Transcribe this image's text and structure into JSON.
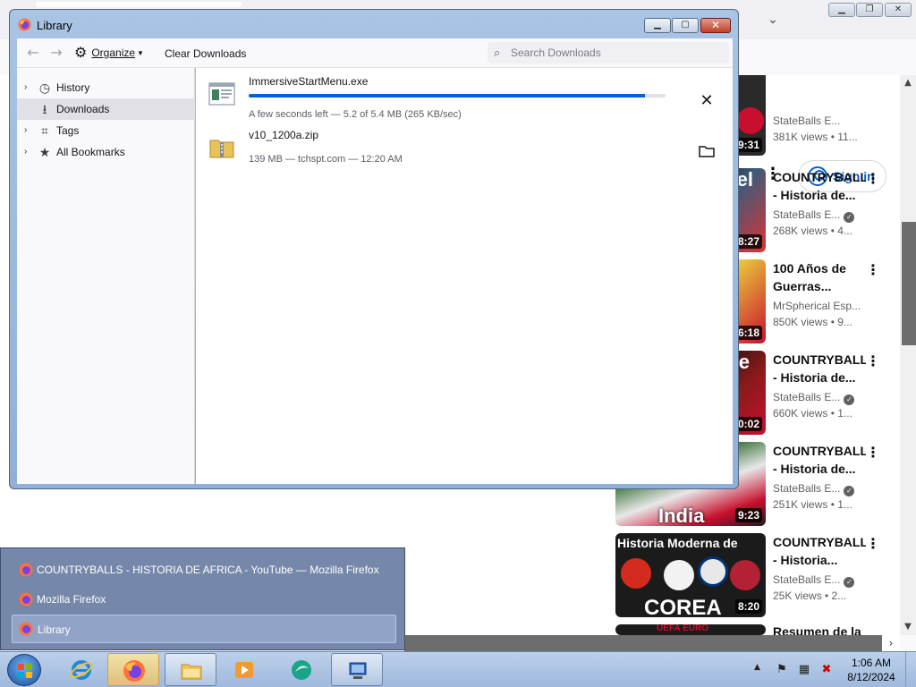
{
  "library": {
    "title": "Library",
    "toolbar": {
      "organize_label": "Organize",
      "clear_label": "Clear Downloads",
      "search_placeholder": "Search Downloads"
    },
    "sidebar": {
      "items": [
        {
          "label": "History",
          "icon": "clock-icon"
        },
        {
          "label": "Downloads",
          "icon": "download-icon"
        },
        {
          "label": "Tags",
          "icon": "tag-icon"
        },
        {
          "label": "All Bookmarks",
          "icon": "star-icon"
        }
      ]
    },
    "downloads": [
      {
        "name": "ImmersiveStartMenu.exe",
        "status": "A few seconds left — 5.2 of 5.4 MB (265 KB/sec)",
        "progress": 0.95,
        "action": "cancel"
      },
      {
        "name": "v10_1200a.zip",
        "status": "139 MB — tchspt.com — 12:20 AM",
        "action": "open-folder"
      }
    ]
  },
  "jumplist": {
    "items": [
      {
        "label": "COUNTRYBALLS - HISTORIA DE AFRICA - YouTube — Mozilla Firefox"
      },
      {
        "label": "Mozilla Firefox"
      },
      {
        "label": "Library",
        "selected": true
      }
    ]
  },
  "youtube": {
    "signin_label": "Sign in",
    "videos": [
      {
        "title1": "",
        "title2": "",
        "channel": "StateBalls E...",
        "meta": "381K views • 11...",
        "duration": "9:31"
      },
      {
        "title1": "COUNTRYBALLS",
        "title2": "- Historia de...",
        "channel": "StateBalls E...",
        "meta": "268K views • 4...",
        "duration": "8:27",
        "thumb_text": "el"
      },
      {
        "title1": "100 Años de",
        "title2": "Guerras...",
        "channel": "MrSpherical Esp...",
        "meta": "850K views • 9...",
        "duration": "6:18"
      },
      {
        "title1": "COUNTRYBALLS",
        "title2": "- Historia de...",
        "channel": "StateBalls E...",
        "meta": "660K views • 1...",
        "duration": "0:02",
        "thumb_text": "e"
      },
      {
        "title1": "COUNTRYBALLS",
        "title2": "- Historia de...",
        "channel": "StateBalls E...",
        "meta": "251K views • 1...",
        "duration": "9:23",
        "thumb_text": "India"
      },
      {
        "title1": "COUNTRYBALLS",
        "title2": "- Historia...",
        "channel": "StateBalls E...",
        "meta": "25K views • 2...",
        "duration": "8:20",
        "thumb_text": "COREA",
        "thumb_top": "Historia Moderna de"
      },
      {
        "title1": "Resumen de la",
        "title2": "",
        "thumb_top": "UEFA EURO"
      }
    ]
  },
  "taskbar": {
    "clock_time": "1:06 AM",
    "clock_date": "8/12/2024",
    "buttons": [
      "internet-explorer-icon",
      "firefox-icon",
      "file-explorer-icon",
      "media-player-icon",
      "app-icon",
      "remote-desktop-icon"
    ]
  },
  "colors": {
    "accent": "#0060df",
    "youtube_blue": "#065fd4",
    "titlebar": "#a9c4e4"
  }
}
